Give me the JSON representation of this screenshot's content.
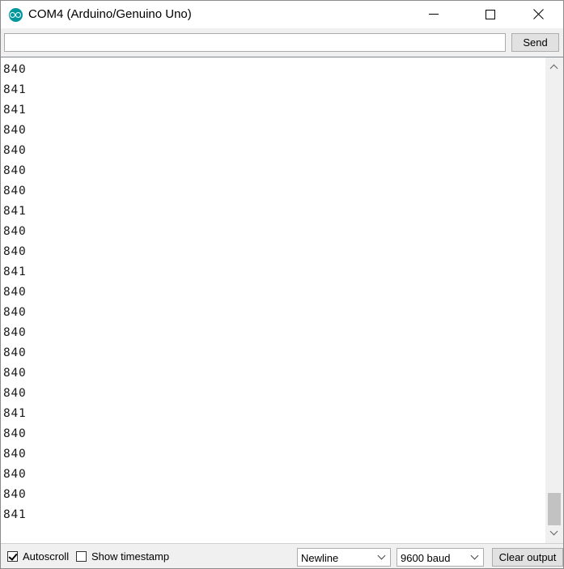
{
  "window": {
    "title": "COM4 (Arduino/Genuino Uno)",
    "app_icon": "arduino-logo-icon",
    "controls": [
      "minimize-icon",
      "maximize-icon",
      "close-icon"
    ]
  },
  "input_row": {
    "input_value": "",
    "send_label": "Send"
  },
  "output": {
    "lines": [
      "840",
      "841",
      "841",
      "840",
      "840",
      "840",
      "840",
      "841",
      "840",
      "840",
      "841",
      "840",
      "840",
      "840",
      "840",
      "840",
      "840",
      "841",
      "840",
      "840",
      "840",
      "840",
      "841"
    ]
  },
  "footer": {
    "autoscroll_label": "Autoscroll",
    "autoscroll_checked": true,
    "timestamp_label": "Show timestamp",
    "timestamp_checked": false,
    "line_ending": "Newline",
    "baud_rate": "9600 baud",
    "clear_label": "Clear output"
  },
  "colors": {
    "accent": "#00979d",
    "titlebar": "#ffffff",
    "chrome": "#f0f0f0"
  }
}
